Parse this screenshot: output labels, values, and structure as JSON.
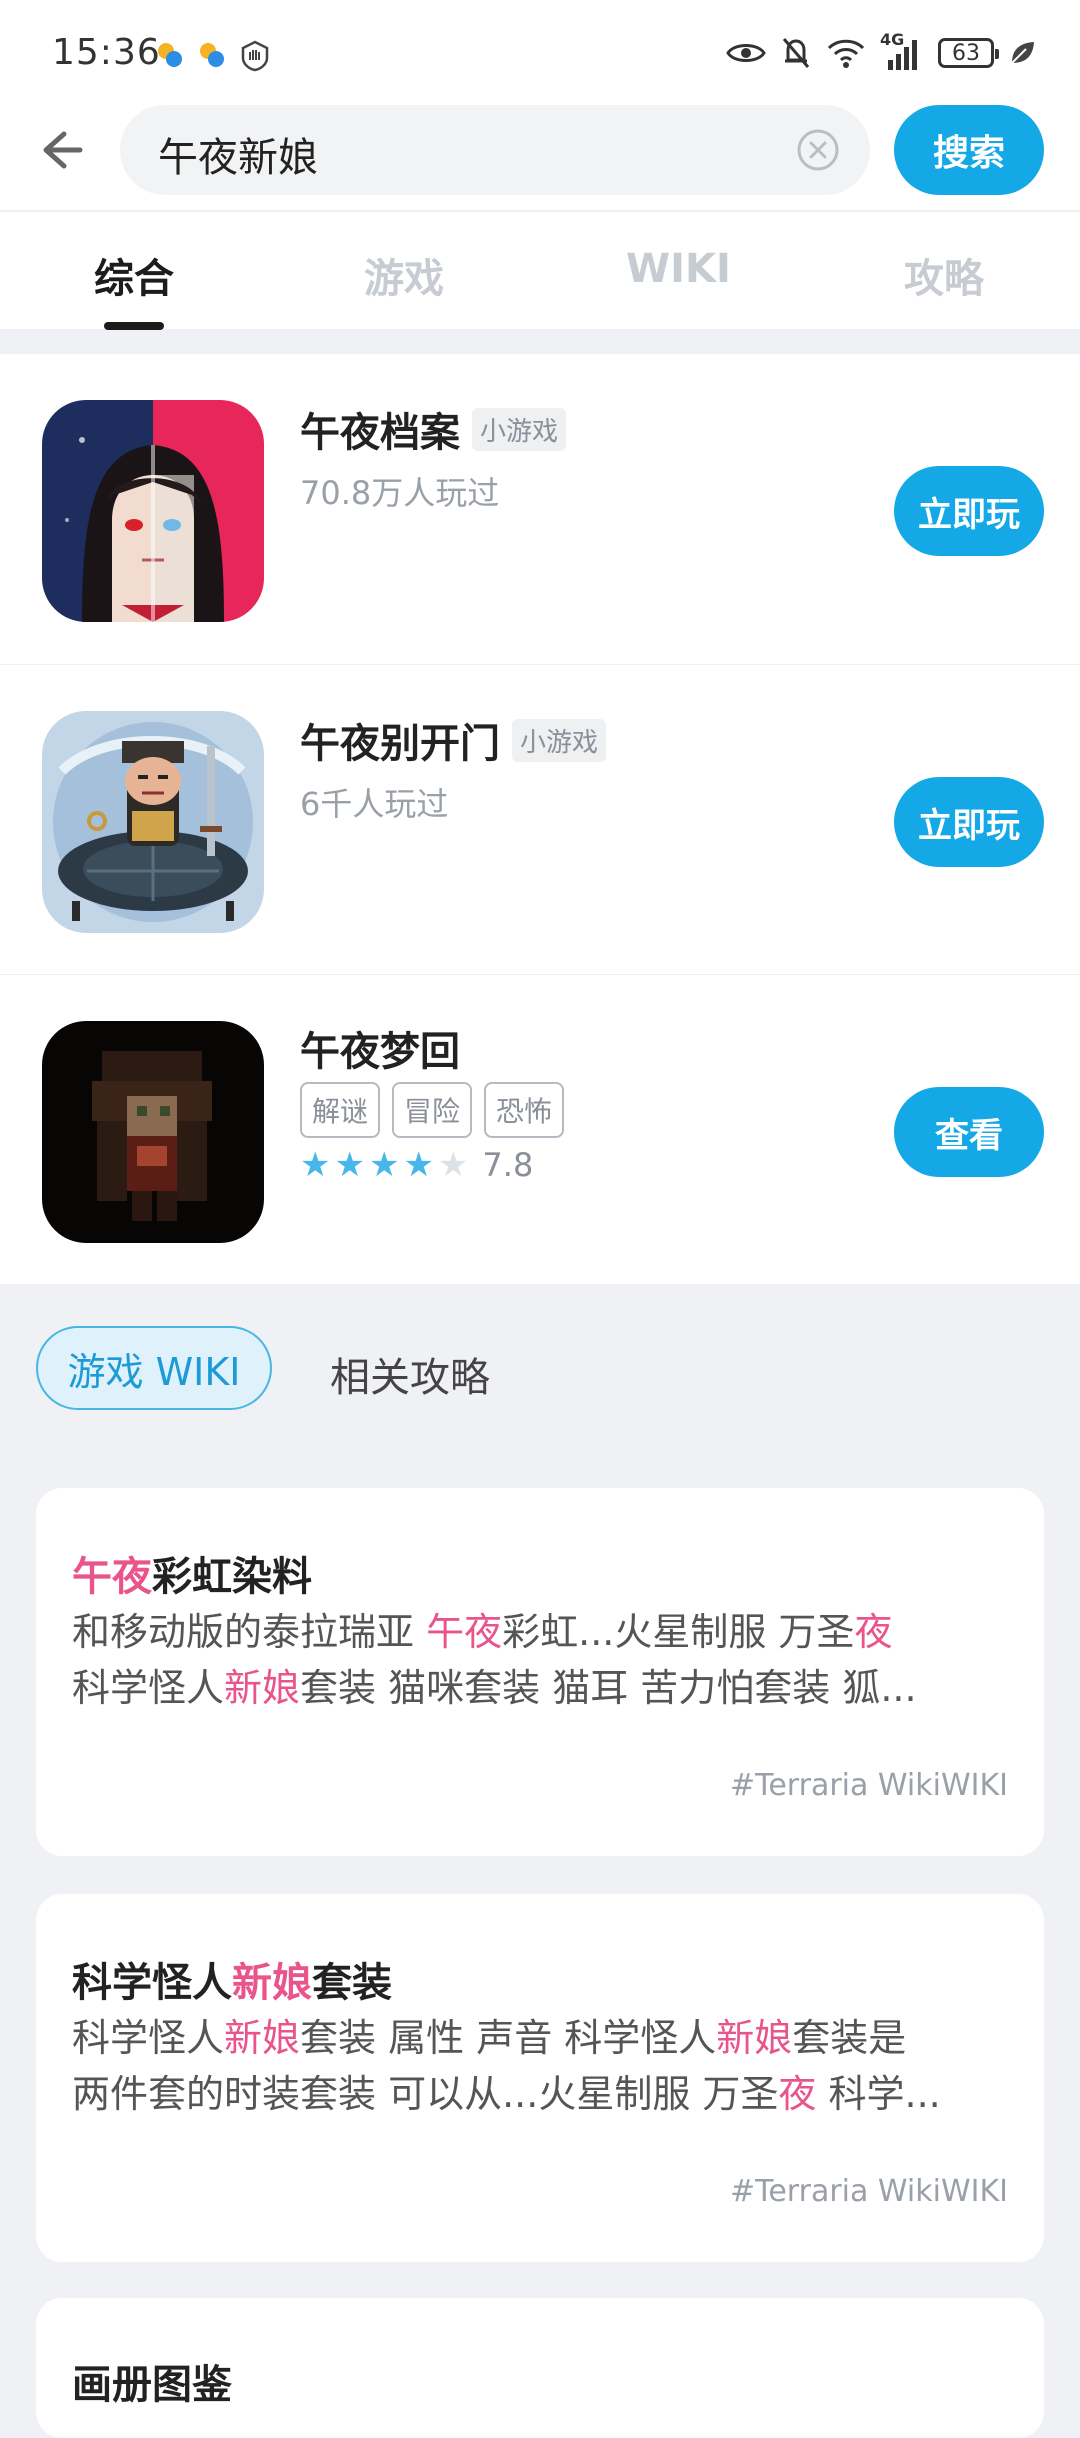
{
  "status_bar": {
    "time": "15:36",
    "battery": "63",
    "network": "4G"
  },
  "search": {
    "back_icon": "back-arrow-icon",
    "query": "午夜新娘",
    "clear_icon": "clear-circle-icon",
    "button_label": "搜索"
  },
  "tabs": [
    {
      "label": "综合",
      "active": true
    },
    {
      "label": "游戏",
      "active": false
    },
    {
      "label": "WIKI",
      "active": false
    },
    {
      "label": "攻略",
      "active": false
    }
  ],
  "games": [
    {
      "title": "午夜档案",
      "tag": "小游戏",
      "subtitle": "70.8万人玩过",
      "button": "立即玩"
    },
    {
      "title": "午夜别开门",
      "tag": "小游戏",
      "subtitle": "6千人玩过",
      "button": "立即玩"
    },
    {
      "title": "午夜梦回",
      "genres": [
        "解谜",
        "冒险",
        "恐怖"
      ],
      "rating": 7.8,
      "stars_filled": 4,
      "stars_total": 5,
      "button": "查看"
    }
  ],
  "sections": {
    "wiki_label": "游戏 WIKI",
    "guides_label": "相关攻略"
  },
  "wiki_cards": [
    {
      "title": {
        "hl": "午夜",
        "rest": "彩虹染料"
      },
      "body_line1": [
        {
          "t": "和移动版的泰拉瑞亚 ",
          "h": false
        },
        {
          "t": "午夜",
          "h": true
        },
        {
          "t": "彩虹...火星制服 万圣",
          "h": false
        },
        {
          "t": "夜",
          "h": true
        }
      ],
      "body_line2": [
        {
          "t": "科学怪人",
          "h": false
        },
        {
          "t": "新娘",
          "h": true
        },
        {
          "t": "套装 猫咪套装 猫耳 苦力怕套装 狐...",
          "h": false
        }
      ],
      "source": "#Terraria WikiWIKI"
    },
    {
      "title": {
        "pre": "科学怪人",
        "hl": "新娘",
        "post": "套装"
      },
      "body_line1": [
        {
          "t": "科学怪人",
          "h": false
        },
        {
          "t": "新娘",
          "h": true
        },
        {
          "t": "套装 属性 声音 科学怪人",
          "h": false
        },
        {
          "t": "新娘",
          "h": true
        },
        {
          "t": "套装是",
          "h": false
        }
      ],
      "body_line2": [
        {
          "t": "两件套的时装套装 可以从...火星制服 万圣",
          "h": false
        },
        {
          "t": "夜",
          "h": true
        },
        {
          "t": " 科学...",
          "h": false
        }
      ],
      "source": "#Terraria WikiWIKI"
    },
    {
      "title": {
        "text": "画册图鉴"
      }
    }
  ]
}
